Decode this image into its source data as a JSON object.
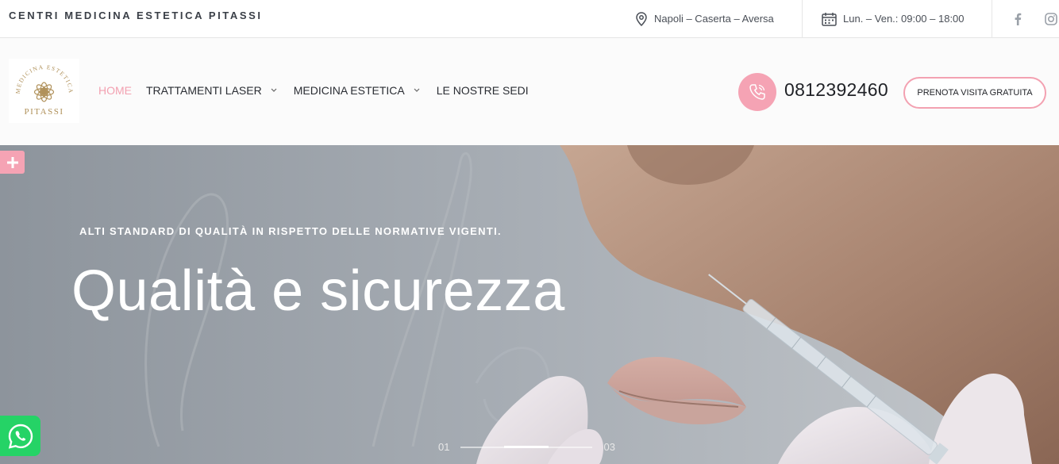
{
  "topbar": {
    "brand": "CENTRI MEDICINA ESTETICA PITASSI",
    "location": "Napoli – Caserta – Aversa",
    "hours": "Lun. – Ven.: 09:00 – 18:00",
    "social": {
      "facebook_icon": "facebook-icon",
      "instagram_icon": "instagram-icon"
    }
  },
  "header": {
    "logo": {
      "line1": "MEDICINA ESTETICA",
      "line2": "PITASSI"
    },
    "nav": [
      {
        "label": "HOME",
        "active": true,
        "has_dropdown": false
      },
      {
        "label": "TRATTAMENTI LASER",
        "active": false,
        "has_dropdown": true
      },
      {
        "label": "MEDICINA ESTETICA",
        "active": false,
        "has_dropdown": true
      },
      {
        "label": "LE NOSTRE SEDI",
        "active": false,
        "has_dropdown": false
      }
    ],
    "phone": "0812392460",
    "cta": "PRENOTA VISITA GRATUITA"
  },
  "hero": {
    "kicker": "ALTI STANDARD DI QUALITÀ IN RISPETTO DELLE NORMATIVE VIGENTI.",
    "title": "Qualità e sicurezza",
    "slider": {
      "current": "01",
      "total": "03"
    }
  },
  "colors": {
    "accent": "#f5a3b4",
    "text_dark": "#2a2d33",
    "whatsapp": "#25d366"
  }
}
